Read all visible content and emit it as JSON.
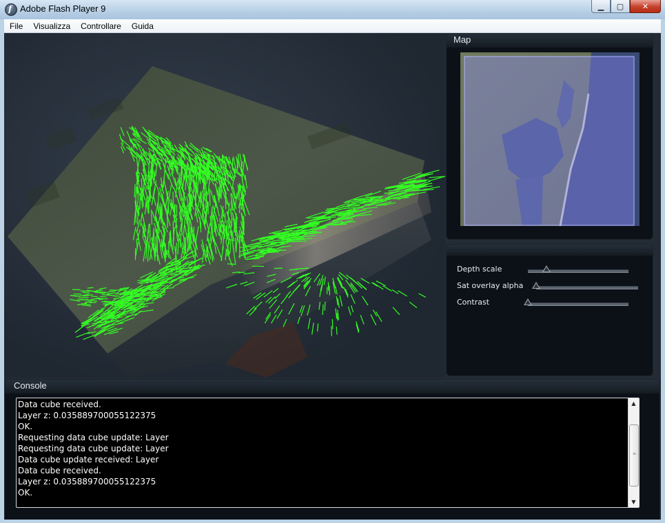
{
  "window": {
    "title": "Adobe Flash Player 9",
    "app_icon": "flash-player-icon",
    "controls": {
      "minimize": "▁",
      "maximize": "▢",
      "close": "✕"
    }
  },
  "menubar": {
    "items": [
      "File",
      "Visualizza",
      "Controllare",
      "Guida"
    ]
  },
  "map_panel": {
    "title": "Map"
  },
  "controls_panel": {
    "sliders": [
      {
        "label": "Depth scale",
        "value": 0.18
      },
      {
        "label": "Sat overlay alpha",
        "value": 0.0
      },
      {
        "label": "Contrast",
        "value": 0.0
      }
    ]
  },
  "console": {
    "title": "Console",
    "lines": [
      "Data cube received.",
      "Layer z: 0.035889700055122375",
      "OK.",
      "Requesting data cube update: Layer",
      "Requesting data cube update: Layer",
      "Data cube update received: Layer",
      "Data cube received.",
      "Layer z: 0.035889700055122375",
      "OK."
    ]
  },
  "colors": {
    "vector_green": "#33ff22",
    "panel_bg": "#0c1117",
    "map_overlay": "#8f8fff"
  }
}
